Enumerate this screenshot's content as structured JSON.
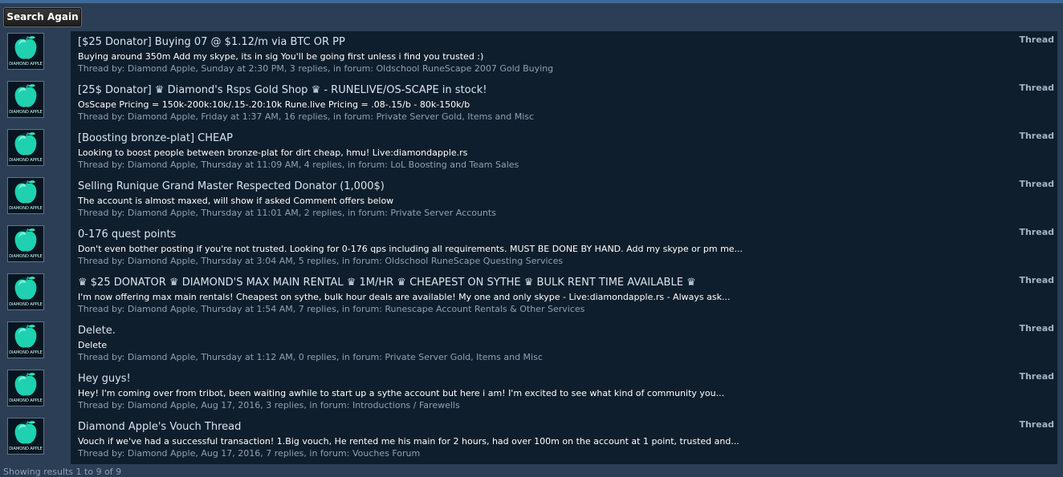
{
  "toolbar": {
    "search_again_label": "Search Again"
  },
  "colors": {
    "accent": "#3d6a9a",
    "row_bg": "#0e1e2c",
    "page_bg": "#2c3e55",
    "avatar_green": "#1fd1b0"
  },
  "avatar": {
    "icon": "diamond-apple-avatar",
    "caption": "DIAMOND APPLE"
  },
  "results": [
    {
      "title": "[$25 Donator] Buying 07 @ $1.12/m via BTC OR PP",
      "snippet": "Buying around 350m Add my skype, its in sig You'll be going first unless i find you trusted :)",
      "meta": "Thread by: Diamond Apple, Sunday at 2:30 PM, 3 replies, in forum: Oldschool RuneScape 2007 Gold Buying",
      "type": "Thread"
    },
    {
      "title": "[25$ Donator] ♛ Diamond's Rsps Gold Shop ♛ - RUNELIVE/OS-SCAPE in stock!",
      "snippet": "OsScape Pricing = 150k-200k:10k/.15-.20:10k Rune.live Pricing = .08-.15/b - 80k-150k/b",
      "meta": "Thread by: Diamond Apple, Friday at 1:37 AM, 16 replies, in forum: Private Server Gold, Items and Misc",
      "type": "Thread"
    },
    {
      "title": "[Boosting bronze-plat] CHEAP",
      "snippet": "Looking to boost people between bronze-plat for dirt cheap, hmu! Live:diamondapple.rs",
      "meta": "Thread by: Diamond Apple, Thursday at 11:09 AM, 4 replies, in forum: LoL Boosting and Team Sales",
      "type": "Thread"
    },
    {
      "title": "Selling Runique Grand Master Respected Donator (1,000$)",
      "snippet": "The account is almost maxed, will show if asked Comment offers below",
      "meta": "Thread by: Diamond Apple, Thursday at 11:01 AM, 2 replies, in forum: Private Server Accounts",
      "type": "Thread"
    },
    {
      "title": "0-176 quest points",
      "snippet": "Don't even bother posting if you're not trusted. Looking for 0-176 qps including all requirements. MUST BE DONE BY HAND. Add my skype or pm me...",
      "meta": "Thread by: Diamond Apple, Thursday at 3:04 AM, 5 replies, in forum: Oldschool RuneScape Questing Services",
      "type": "Thread"
    },
    {
      "title": "♛ $25 DONATOR ♛ DIAMOND'S MAX MAIN RENTAL ♛ 1M/HR ♛ CHEAPEST ON SYTHE ♛ BULK RENT TIME AVAILABLE ♛",
      "snippet": "I'm now offering max main rentals! Cheapest on sythe, bulk hour deals are available! My one and only skype - Live:diamondapple.rs - Always ask...",
      "meta": "Thread by: Diamond Apple, Thursday at 1:54 AM, 7 replies, in forum: Runescape Account Rentals & Other Services",
      "type": "Thread"
    },
    {
      "title": "Delete.",
      "snippet": "Delete",
      "meta": "Thread by: Diamond Apple, Thursday at 1:12 AM, 0 replies, in forum: Private Server Gold, Items and Misc",
      "type": "Thread"
    },
    {
      "title": "Hey guys!",
      "snippet": "Hey! I'm coming over from tribot, been waiting awhile to start up a sythe account but here i am! I'm excited to see what kind of community you...",
      "meta": "Thread by: Diamond Apple, Aug 17, 2016, 3 replies, in forum: Introductions / Farewells",
      "type": "Thread"
    },
    {
      "title": "Diamond Apple's Vouch Thread",
      "snippet": "Vouch if we've had a successful transaction! 1.Big vouch, He rented me his main for 2 hours, had over 100m on the account at 1 point, trusted and...",
      "meta": "Thread by: Diamond Apple, Aug 17, 2016, 7 replies, in forum: Vouches Forum",
      "type": "Thread"
    }
  ],
  "footer": {
    "showing_text": "Showing results 1 to 9 of 9"
  }
}
